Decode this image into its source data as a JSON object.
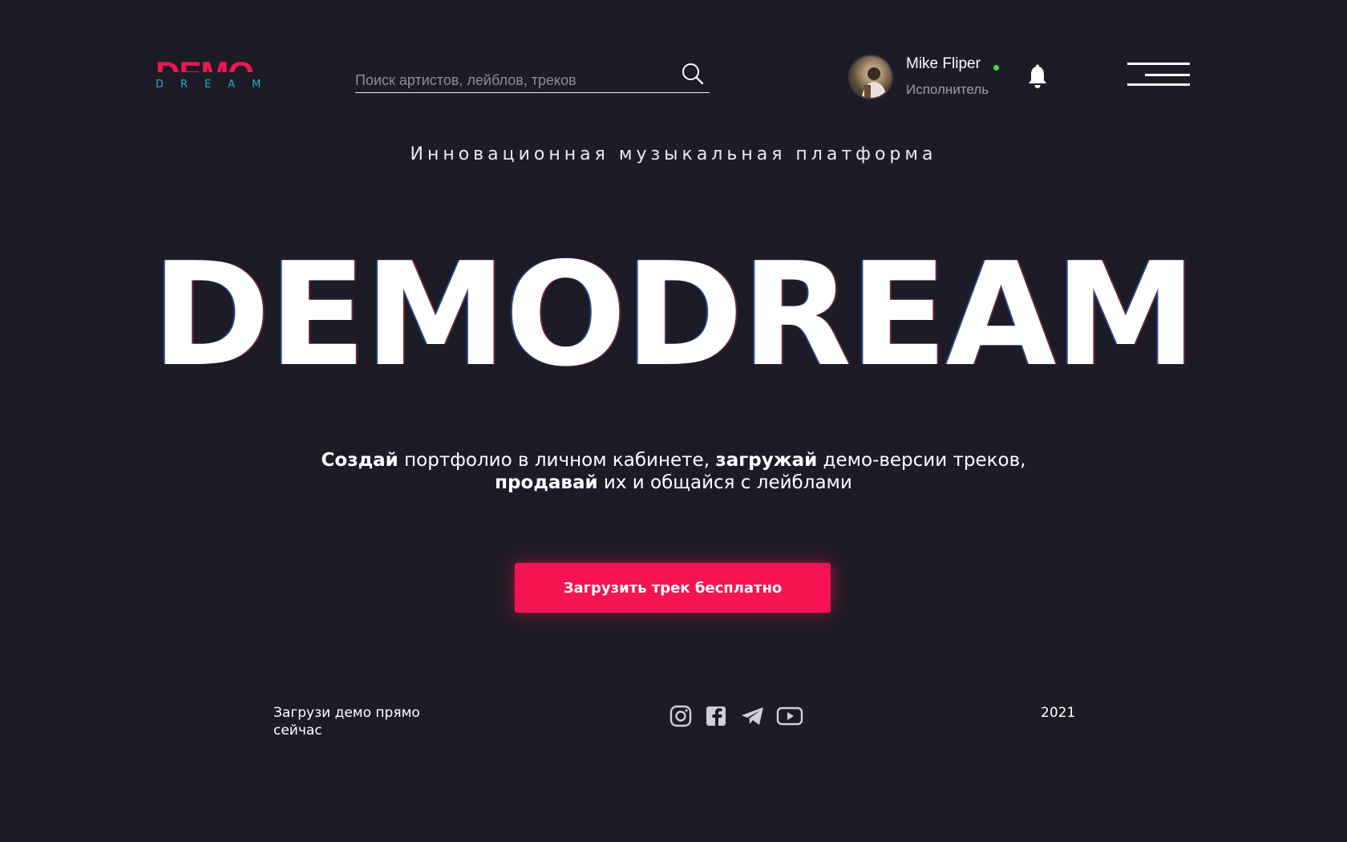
{
  "logo": {
    "top": "DEMO",
    "bottom": "DREAM"
  },
  "search": {
    "placeholder": "Поиск артистов, лейблов, треков",
    "value": "",
    "icon": "search-icon"
  },
  "user": {
    "name": "Mike Fliper",
    "role": "Исполнитель",
    "status_color": "#3ddc3d"
  },
  "hero": {
    "tagline": "Инновационная музыкальная платформа",
    "title": "DEMODREAM",
    "description": {
      "w1": "Создай",
      "t1": " портфолио в личном кабинете, ",
      "w2": "загружай",
      "t2": " демо-версии треков, ",
      "w3": "продавай",
      "t3": " их и общайся с лейблами"
    },
    "cta": "Загрузить трек бесплатно"
  },
  "footer": {
    "text": "Загрузи демо прямо сейчас",
    "social": [
      "instagram-icon",
      "facebook-icon",
      "telegram-icon",
      "youtube-icon"
    ],
    "year": "2021"
  },
  "colors": {
    "background": "#1d1c26",
    "accent": "#f51451",
    "logo_bottom": "#2aa9c9",
    "icons": "#cfcfd6"
  }
}
